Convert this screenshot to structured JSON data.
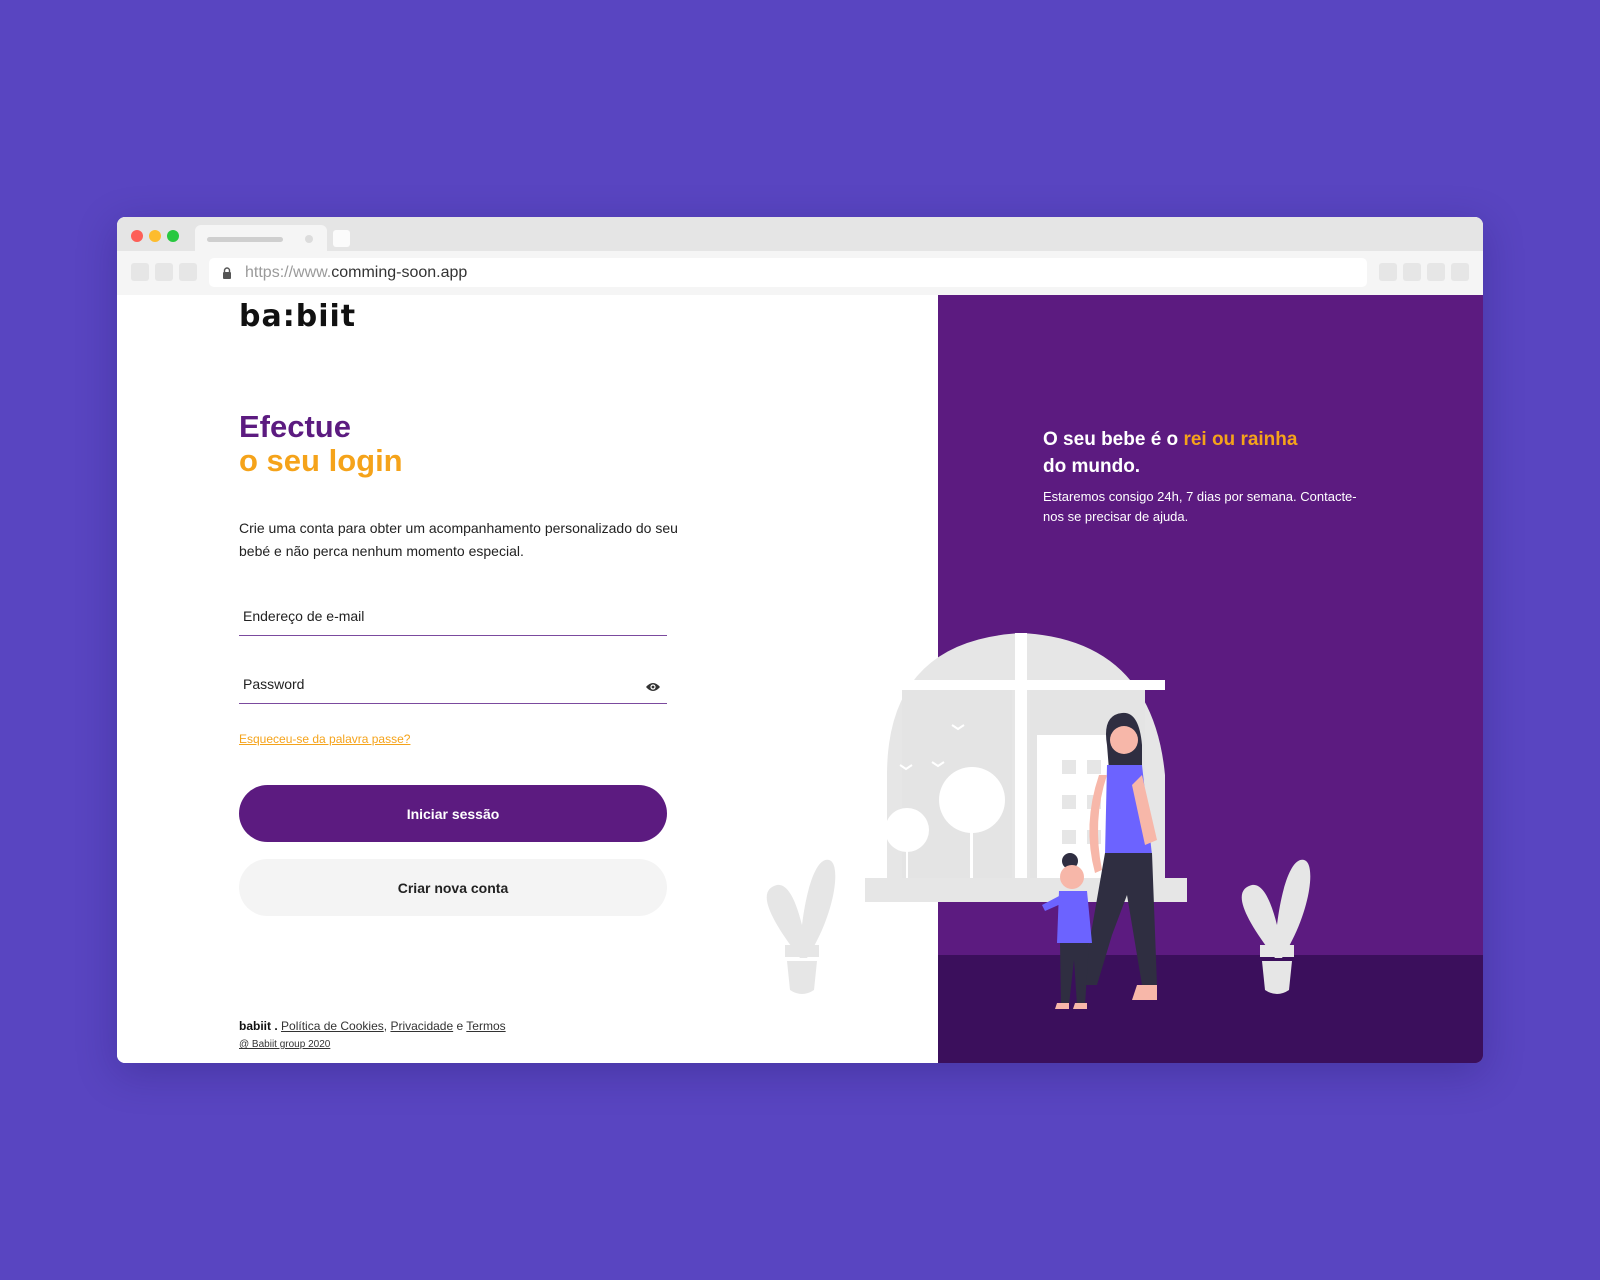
{
  "browser": {
    "url_prefix": "https://www.",
    "url_domain": "comming-soon.app"
  },
  "brand": {
    "logo_text": "ba:biit"
  },
  "login": {
    "title_line1": "Efectue",
    "title_line2": "o seu login",
    "description": "Crie uma conta para obter um acompanhamento personalizado do seu bebé e não perca nenhum momento especial.",
    "email_placeholder": "Endereço de e-mail",
    "password_placeholder": "Password",
    "forgot_link": "Esqueceu-se da palavra passe?",
    "login_button": "Iniciar sessão",
    "signup_button": "Criar nova conta"
  },
  "footer": {
    "brand": "babiit .",
    "cookies": "Política de Cookies",
    "sep": ",",
    "privacy": "Privacidade",
    "and": "e",
    "terms": "Termos",
    "copyright": "@ Babiit group 2020"
  },
  "promo": {
    "title_part1": "O seu bebe é o ",
    "title_highlight": "rei ou rainha",
    "title_part2": "do mundo.",
    "subtitle": "Estaremos consigo 24h, 7 dias por semana. Contacte-nos se precisar de ajuda."
  },
  "colors": {
    "background": "#5945c1",
    "brand_purple": "#5c1b80",
    "brand_orange": "#f5a31a",
    "floor": "#3b0f5c"
  },
  "icons": [
    "lock-icon",
    "eye-icon"
  ]
}
